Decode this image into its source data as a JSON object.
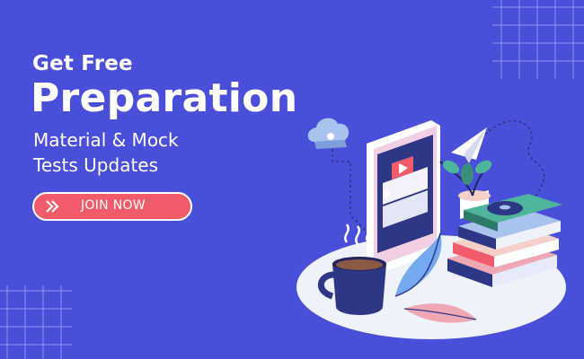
{
  "colors": {
    "background": "#4a4fd9",
    "button": "#f25c6a",
    "text": "#ffffff"
  },
  "headline": {
    "line1": "Get Free",
    "line2": "Preparation",
    "line3": "Material & Mock",
    "line4": "Tests Updates"
  },
  "cta": {
    "label": "JOIN NOW",
    "icon": "double-chevron-right-icon"
  },
  "illustration": {
    "icons": [
      "cloud-icon",
      "phone-icon",
      "paper-plane-icon",
      "coffee-cup-icon",
      "plant-icon",
      "book-stack-icon",
      "disc-icon",
      "leaf-icon"
    ]
  }
}
